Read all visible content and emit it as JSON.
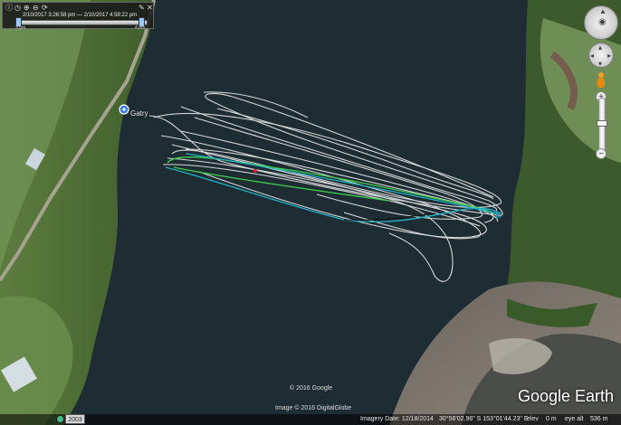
{
  "map": {
    "placemark_label": "Gatry",
    "copyright_main": "© 2016 Google",
    "copyright_imagery": "Image © 2016 DigitalGlobe",
    "logo": "Google Earth"
  },
  "time_slider": {
    "range_text": "2/10/2017  3:26:58 pm  —  2/10/2017  4:59:22 pm",
    "start_tick": "3 pm",
    "end_tick": "4 pm",
    "icons": [
      "info-icon",
      "clock-icon",
      "zoom-in-icon",
      "zoom-out-icon",
      "refresh-icon",
      "wrench-icon",
      "close-icon"
    ]
  },
  "status_bar": {
    "year": "2003",
    "imagery_date": "Imagery Date: 12/18/2014",
    "coordinates": "30°56'02.96\" S  153°01'44.23\" E",
    "elev_label": "elev",
    "elev_value": "0 m",
    "eye_alt_label": "eye alt",
    "eye_alt_value": "536 m"
  },
  "colors": {
    "water": "#1f2d35",
    "track_primary": "#e6e6e6",
    "track_green": "#3fd24a",
    "track_cyan": "#1fb3c8"
  }
}
